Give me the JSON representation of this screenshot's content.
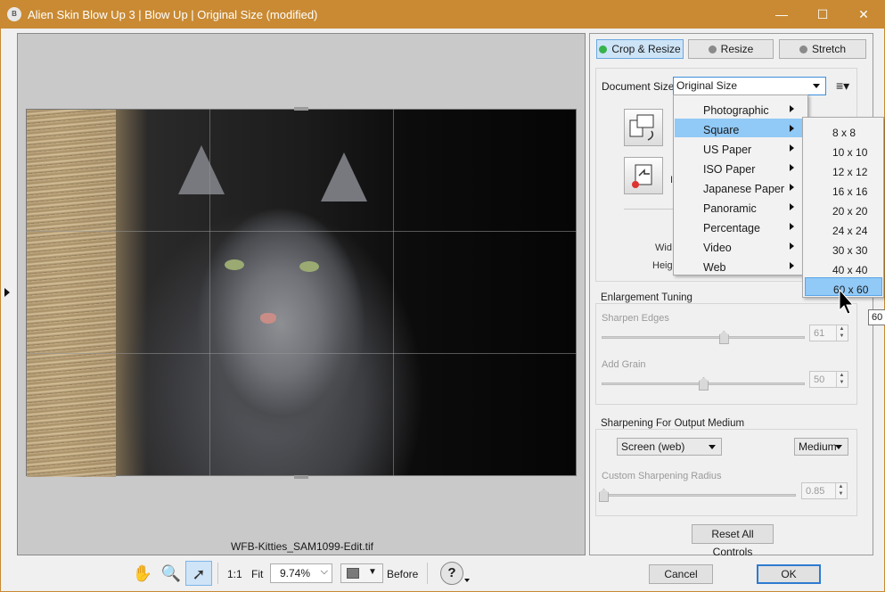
{
  "window": {
    "title": "Alien Skin Blow Up 3 | Blow Up | Original Size (modified)",
    "app_icon_text": "B",
    "minimize_glyph": "—",
    "maximize_glyph": "☐",
    "close_glyph": "✕"
  },
  "canvas": {
    "filename": "WFB-Kitties_SAM1099-Edit.tif"
  },
  "toolbar": {
    "one_to_one": "1:1",
    "fit": "Fit",
    "zoom_value": "9.74%",
    "before_label": "Before",
    "help": "?",
    "cancel": "Cancel",
    "ok": "OK"
  },
  "panel": {
    "tabs": [
      {
        "label": "Crop & Resize",
        "active": true
      },
      {
        "label": "Resize",
        "active": false
      },
      {
        "label": "Stretch",
        "active": false
      }
    ],
    "document_size_label": "Document Size",
    "document_size_value": "Original Size",
    "width_label_partial": "Wid",
    "height_label_partial": "Heig",
    "enlargement_tuning": "Enlargement Tuning",
    "sharpen_edges_label": "Sharpen Edges",
    "sharpen_edges_value": "61",
    "sharpen_edges_level": 0.6,
    "add_grain_label": "Add Grain",
    "add_grain_value": "50",
    "add_grain_level": 0.5,
    "sharpening_output_label": "Sharpening For Output Medium",
    "output_medium_value": "Screen (web)",
    "output_strength_value": "Medium",
    "custom_radius_label": "Custom Sharpening Radius",
    "custom_radius_value": "0.85",
    "custom_radius_level": 0.0,
    "reset_label": "Reset All Controls"
  },
  "size_menu": {
    "items": [
      {
        "label": "Photographic",
        "highlighted": false
      },
      {
        "label": "Square",
        "highlighted": true
      },
      {
        "label": "US Paper",
        "highlighted": false
      },
      {
        "label": "ISO Paper",
        "highlighted": false
      },
      {
        "label": "Japanese Paper",
        "highlighted": false
      },
      {
        "label": "Panoramic",
        "highlighted": false
      },
      {
        "label": "Percentage",
        "highlighted": false
      },
      {
        "label": "Video",
        "highlighted": false
      },
      {
        "label": "Web",
        "highlighted": false
      }
    ]
  },
  "square_submenu": {
    "items": [
      {
        "label": "8 x 8",
        "highlighted": false
      },
      {
        "label": "10 x 10",
        "highlighted": false
      },
      {
        "label": "12 x 12",
        "highlighted": false
      },
      {
        "label": "16 x 16",
        "highlighted": false
      },
      {
        "label": "20 x 20",
        "highlighted": false
      },
      {
        "label": "24 x 24",
        "highlighted": false
      },
      {
        "label": "30 x 30",
        "highlighted": false
      },
      {
        "label": "40 x 40",
        "highlighted": false
      },
      {
        "label": "60 x 60",
        "highlighted": true
      }
    ],
    "tooltip": "60"
  },
  "colors": {
    "titlebar": "#c98a33",
    "highlight": "#91c9f7",
    "active_led": "#38b34a"
  }
}
